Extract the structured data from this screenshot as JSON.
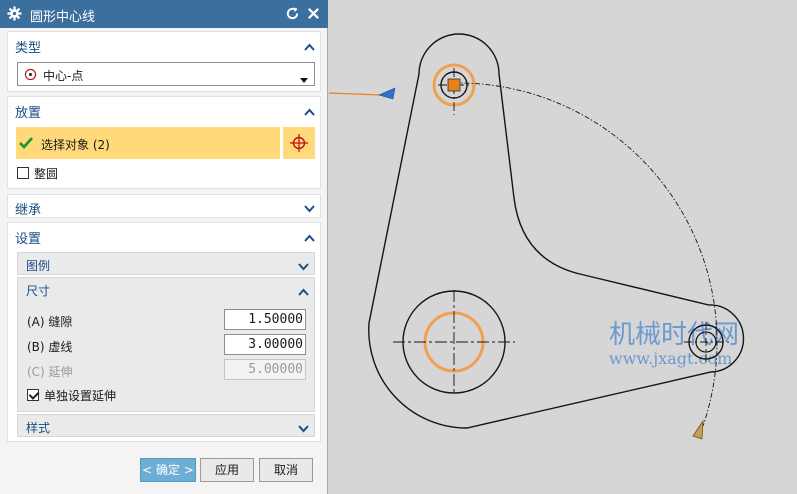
{
  "dialog": {
    "title": "圆形中心线",
    "icons": {
      "title": "gear-icon",
      "reset": "reset-icon",
      "close": "close-icon"
    },
    "sections": {
      "type": {
        "title": "类型",
        "combo_value": "中心-点"
      },
      "placement": {
        "title": "放置",
        "select_label": "选择对象 (2)",
        "full_circle_label": "整圆",
        "full_circle_checked": false
      },
      "inherit": {
        "title": "继承"
      },
      "settings": {
        "title": "设置",
        "legend": {
          "title": "图例"
        },
        "dimensions": {
          "title": "尺寸",
          "gap_label": "(A) 缝隙",
          "gap_value": "1.50000",
          "dash_label": "(B) 虚线",
          "dash_value": "3.00000",
          "extension_label": "(C) 延伸",
          "extension_value": "5.00000",
          "separate_extension_label": "单独设置延伸",
          "separate_extension_checked": true
        },
        "style": {
          "title": "样式"
        }
      }
    },
    "buttons": {
      "ok": "< 确定 >",
      "apply": "应用",
      "cancel": "取消"
    }
  },
  "watermark": {
    "line1": "机械时代网",
    "line2": "www.jxagt.com"
  },
  "colors": {
    "title_bar": "#3b6f9e",
    "section_title": "#1a4d86",
    "selection_highlight": "#ffd97a",
    "highlight_circle": "#f0a050",
    "selected_point": "#e8801e",
    "viewport": "#d6d6d6",
    "ok_button": "#6faed4"
  }
}
